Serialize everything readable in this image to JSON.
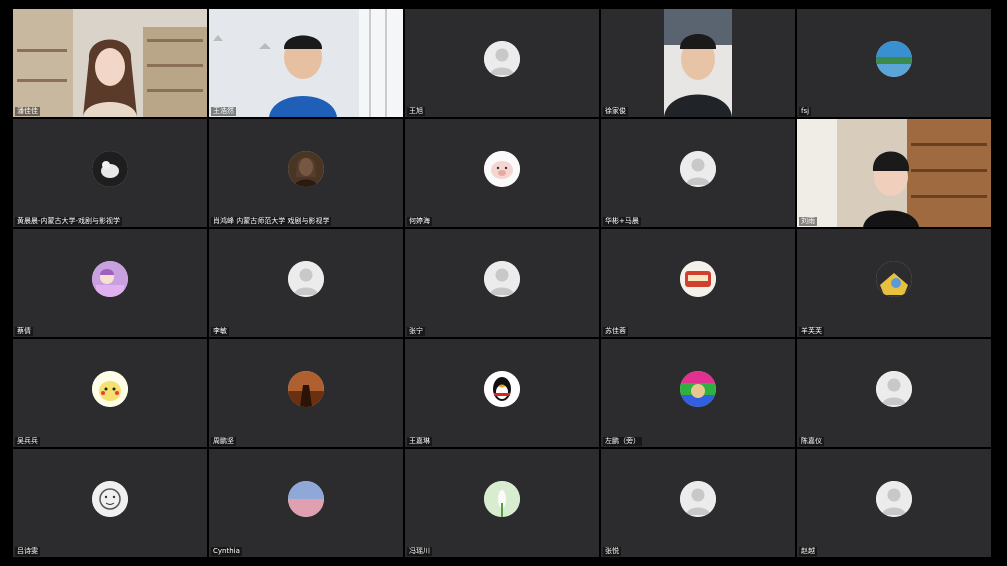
{
  "meeting": {
    "participants": [
      {
        "name": "潘佳佳",
        "type": "video",
        "scene": "bookshelf-room"
      },
      {
        "name": "王浩然",
        "type": "video",
        "scene": "office-window"
      },
      {
        "name": "王旭",
        "type": "avatar",
        "icon": "default-person-icon"
      },
      {
        "name": "徐家俊",
        "type": "video",
        "scene": "portrait-dark"
      },
      {
        "name": "fsj",
        "type": "avatar",
        "icon": "landscape-photo-icon",
        "color": "#3a8fd0"
      },
      {
        "name": "黄晨晨-内蒙古大学-戏剧与影视学",
        "type": "avatar",
        "icon": "cat-photo-icon",
        "color": "#1e1e1e"
      },
      {
        "name": "肖鸿峰 内蒙古师范大学 戏剧与影视学",
        "type": "avatar",
        "icon": "portrait-painting-icon",
        "color": "#4a3424"
      },
      {
        "name": "何婷海",
        "type": "avatar",
        "icon": "pig-cartoon-icon",
        "color": "#f5d5d0"
      },
      {
        "name": "华彬+马晨",
        "type": "avatar",
        "icon": "default-person-icon"
      },
      {
        "name": "刘雨",
        "type": "video",
        "scene": "home-shelf"
      },
      {
        "name": "蔡倩",
        "type": "avatar",
        "icon": "anime-purple-icon",
        "color": "#c8a0e0"
      },
      {
        "name": "李敏",
        "type": "avatar",
        "icon": "default-person-icon"
      },
      {
        "name": "张宁",
        "type": "avatar",
        "icon": "default-person-icon"
      },
      {
        "name": "苏佳蓉",
        "type": "avatar",
        "icon": "food-photo-icon",
        "color": "#d04030"
      },
      {
        "name": "羊芙芙",
        "type": "avatar",
        "icon": "anime-yellow-icon",
        "color": "#e8c040"
      },
      {
        "name": "吴兵兵",
        "type": "avatar",
        "icon": "pikachu-icon",
        "color": "#f5e070"
      },
      {
        "name": "周鹏坚",
        "type": "avatar",
        "icon": "sunset-photo-icon",
        "color": "#b06030"
      },
      {
        "name": "王嘉琳",
        "type": "avatar",
        "icon": "qq-penguin-icon",
        "color": "#ffffff"
      },
      {
        "name": "左鹏（旁）",
        "type": "avatar",
        "icon": "colorful-dog-icon",
        "color": "#e03090"
      },
      {
        "name": "陈嘉仪",
        "type": "avatar",
        "icon": "default-person-icon"
      },
      {
        "name": "吕诗雯",
        "type": "avatar",
        "icon": "sketch-face-icon",
        "color": "#f0f0f0"
      },
      {
        "name": "Cynthia",
        "type": "avatar",
        "icon": "sky-photo-icon",
        "color": "#e0a0b0"
      },
      {
        "name": "冯瑶川",
        "type": "avatar",
        "icon": "flower-photo-icon",
        "color": "#d8ecd0"
      },
      {
        "name": "张悦",
        "type": "avatar",
        "icon": "default-person-icon"
      },
      {
        "name": "赵越",
        "type": "avatar",
        "icon": "default-person-icon"
      }
    ]
  }
}
